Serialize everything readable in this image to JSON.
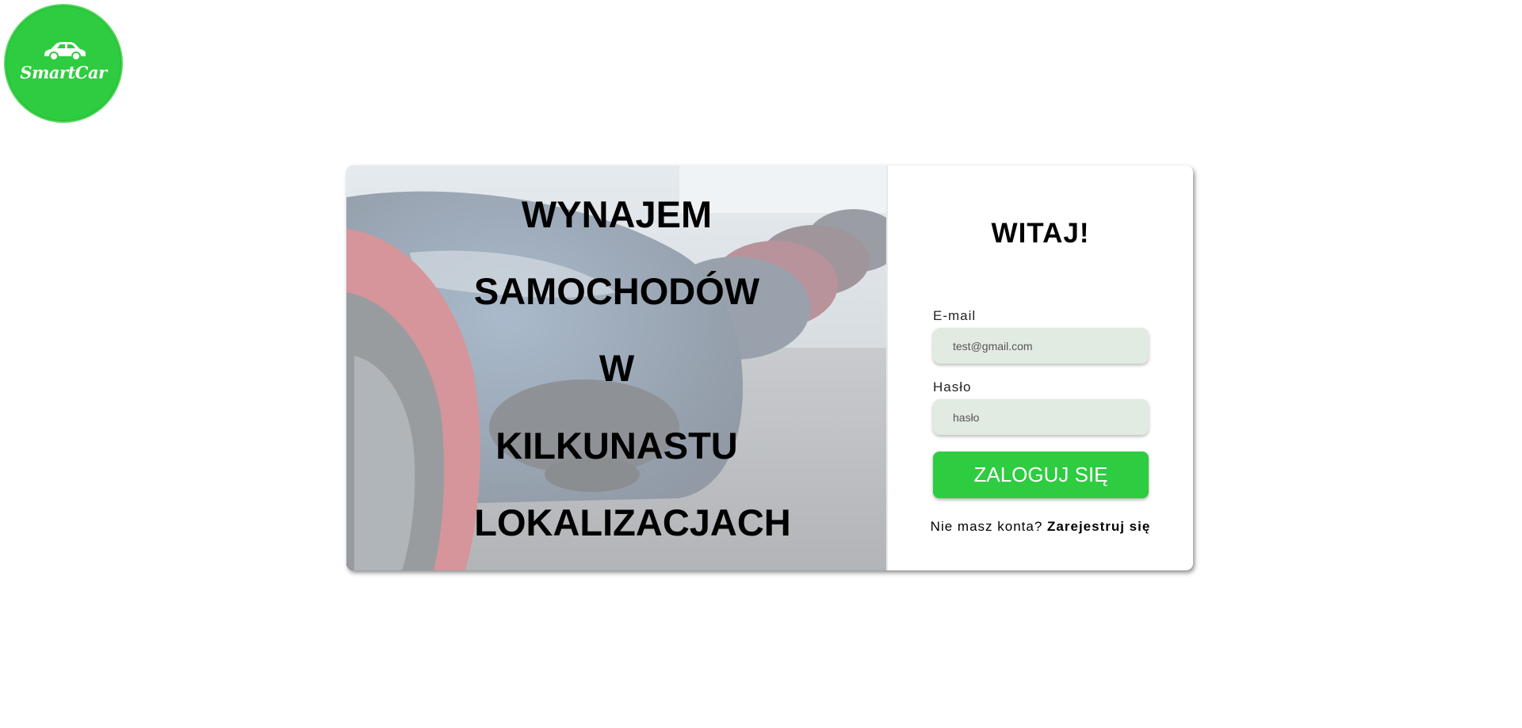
{
  "logo": {
    "text": "SmartCar",
    "icon": "car-icon",
    "color": "#2ecc40"
  },
  "hero": {
    "lines": [
      "WYNAJEM",
      "SAMOCHODÓW",
      "W",
      "KILKUNASTU",
      "LOKALIZACJACH"
    ],
    "background": "car-lot-photo"
  },
  "login": {
    "title": "WITAJ!",
    "email": {
      "label": "E-mail",
      "placeholder": "test@gmail.com",
      "value": ""
    },
    "password": {
      "label": "Hasło",
      "placeholder": "hasło",
      "value": ""
    },
    "submit_label": "ZALOGUJ SIĘ",
    "no_account_text": "Nie masz konta?",
    "register_link": "Zarejestruj się"
  },
  "colors": {
    "accent": "#2ecc40",
    "input_bg": "#e2ebe1"
  }
}
